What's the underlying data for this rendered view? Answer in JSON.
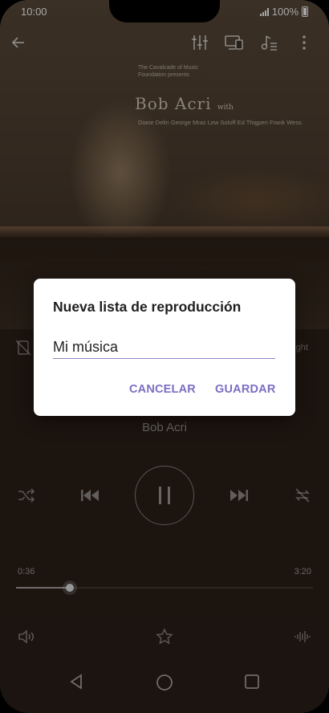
{
  "status_bar": {
    "time": "10:00",
    "battery": "100%"
  },
  "album_art": {
    "presenter_line": "The Cavalcade of Music Foundation presents",
    "title": "Bob Acri",
    "title_suffix": "with",
    "names": "Diane Delin  George Mraz  Lew Soloff  Ed Thigpen  Frank Wess"
  },
  "toolbar": {
    "icons": [
      "back-arrow-icon",
      "equalizer-icon",
      "cast-device-icon",
      "queue-music-icon",
      "more-vert-icon"
    ]
  },
  "now_playing": {
    "right_info": "ight",
    "artist": "Bob Acri",
    "elapsed": "0:36",
    "duration": "3:20",
    "progress_fraction": 0.18
  },
  "dialog": {
    "title": "Nueva lista de reproducción",
    "input_value": "Mi música",
    "cancel_label": "CANCELAR",
    "save_label": "GUARDAR"
  },
  "colors": {
    "accent": "#7b6fc2",
    "input_underline": "#8e85c9"
  }
}
